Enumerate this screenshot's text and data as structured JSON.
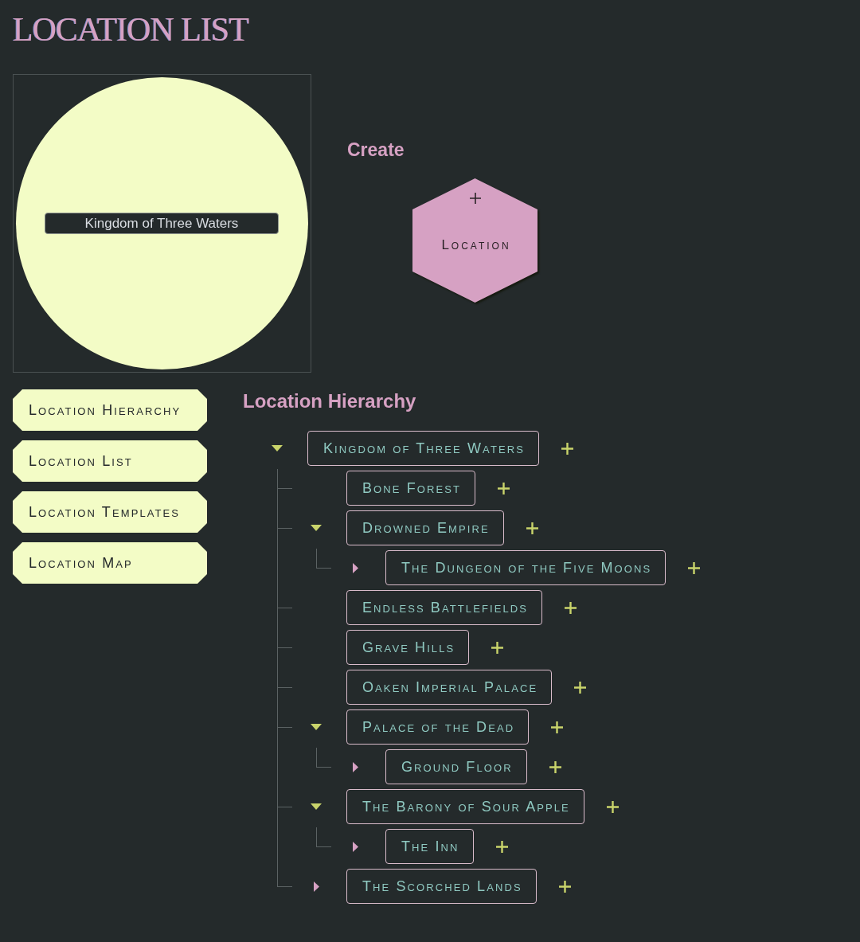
{
  "page": {
    "title": "LOCATION LIST"
  },
  "preview": {
    "label": "Kingdom of Three Waters"
  },
  "create": {
    "heading": "Create",
    "buttons": [
      {
        "label": "Location"
      }
    ]
  },
  "sidebar": {
    "items": [
      {
        "label": "Location Hierarchy"
      },
      {
        "label": "Location List"
      },
      {
        "label": "Location Templates"
      },
      {
        "label": "Location Map"
      }
    ]
  },
  "hierarchy": {
    "heading": "Location Hierarchy",
    "nodes": [
      {
        "label": "Kingdom of Three Waters",
        "kind": "branch",
        "expanded": true,
        "children": [
          {
            "label": "Bone Forest",
            "kind": "leaf"
          },
          {
            "label": "Drowned Empire",
            "kind": "branch",
            "expanded": true,
            "children": [
              {
                "label": "The Dungeon of the Five Moons",
                "kind": "branch",
                "expanded": false
              }
            ]
          },
          {
            "label": "Endless Battlefields",
            "kind": "leaf"
          },
          {
            "label": "Grave Hills",
            "kind": "leaf"
          },
          {
            "label": "Oaken Imperial Palace",
            "kind": "leaf"
          },
          {
            "label": "Palace of the Dead",
            "kind": "branch",
            "expanded": true,
            "children": [
              {
                "label": "Ground Floor",
                "kind": "branch",
                "expanded": false
              }
            ]
          },
          {
            "label": "The Barony of Sour Apple",
            "kind": "branch",
            "expanded": true,
            "children": [
              {
                "label": "The Inn",
                "kind": "branch",
                "expanded": false
              }
            ]
          },
          {
            "label": "The Scorched Lands",
            "kind": "branch",
            "expanded": false
          }
        ]
      }
    ]
  }
}
